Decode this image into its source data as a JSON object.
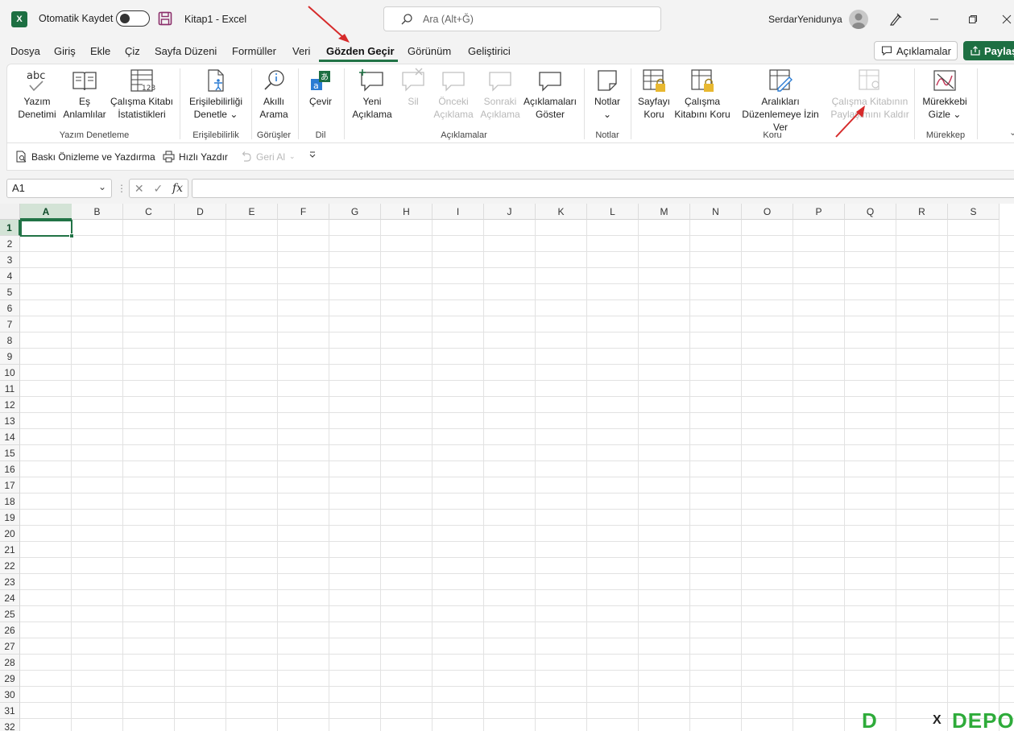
{
  "titlebar": {
    "autosave_label": "Otomatik Kaydet",
    "doc_title": "Kitap1  -  Excel",
    "search_placeholder": "Ara (Alt+Ğ)",
    "username": "SerdarYenidunya"
  },
  "menu": {
    "tabs": [
      "Dosya",
      "Giriş",
      "Ekle",
      "Çiz",
      "Sayfa Düzeni",
      "Formüller",
      "Veri",
      "Gözden Geçir",
      "Görünüm",
      "Geliştirici"
    ],
    "active_tab": "Gözden Geçir",
    "comments_label": "Açıklamalar",
    "share_label": "Paylaş"
  },
  "ribbon": {
    "buttons": {
      "spelling": [
        "Yazım",
        "Denetimi"
      ],
      "thesaurus": [
        "Eş",
        "Anlamlılar"
      ],
      "workbook_stats": [
        "Çalışma Kitabı",
        "İstatistikleri"
      ],
      "check_accessibility": [
        "Erişilebilirliği",
        "Denetle"
      ],
      "smart_lookup": [
        "Akıllı",
        "Arama"
      ],
      "translate": [
        "Çevir",
        ""
      ],
      "new_comment": [
        "Yeni",
        "Açıklama"
      ],
      "delete": [
        "Sil",
        ""
      ],
      "previous_comment": [
        "Önceki",
        "Açıklama"
      ],
      "next_comment": [
        "Sonraki",
        "Açıklama"
      ],
      "show_comments": [
        "Açıklamaları",
        "Göster"
      ],
      "notes": [
        "Notlar",
        ""
      ],
      "protect_sheet": [
        "Sayfayı",
        "Koru"
      ],
      "protect_workbook": [
        "Çalışma",
        "Kitabını Koru"
      ],
      "allow_edit_ranges": [
        "Aralıkları",
        "Düzenlemeye İzin Ver"
      ],
      "unshare_workbook": [
        "Çalışma Kitabının",
        "Paylaşımını Kaldır"
      ],
      "hide_ink": [
        "Mürekkebi",
        "Gizle"
      ]
    },
    "groups": {
      "proofing": "Yazım Denetleme",
      "accessibility": "Erişilebilirlik",
      "insights": "Görüşler",
      "language": "Dil",
      "comments": "Açıklamalar",
      "notes": "Notlar",
      "protect": "Koru",
      "ink": "Mürekkep"
    }
  },
  "qat": {
    "print_preview": "Baskı Önizleme ve Yazdırma",
    "quick_print": "Hızlı Yazdır",
    "undo": "Geri Al"
  },
  "formula_bar": {
    "name_box": "A1",
    "fx": "fx",
    "formula": ""
  },
  "grid": {
    "columns": [
      "A",
      "B",
      "C",
      "D",
      "E",
      "F",
      "G",
      "H",
      "I",
      "J",
      "K",
      "L",
      "M",
      "N",
      "O",
      "P",
      "Q",
      "R",
      "S"
    ],
    "rows": [
      "1",
      "2",
      "3",
      "4",
      "5",
      "6",
      "7",
      "8",
      "9",
      "10",
      "11",
      "12",
      "13",
      "14",
      "15",
      "16",
      "17",
      "18",
      "19",
      "20",
      "21",
      "22",
      "23",
      "24",
      "25",
      "26",
      "27",
      "28",
      "29",
      "30",
      "31",
      "32"
    ],
    "selected_cell": "A1"
  },
  "watermark": {
    "x": "X",
    "brand": "DEPO",
    "d": "D"
  },
  "colors": {
    "accent": "#217346",
    "share_bg": "#1d6f42",
    "annotation_arrow": "#d62a2a"
  }
}
